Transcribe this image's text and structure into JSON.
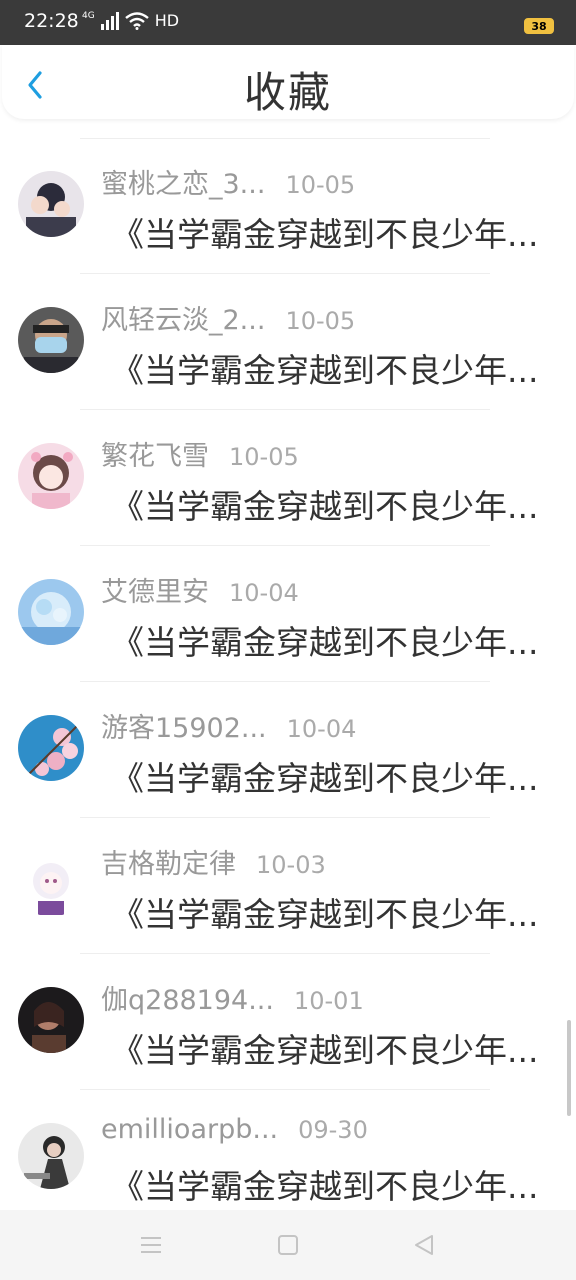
{
  "status_bar": {
    "time": "22:28",
    "network": "4G",
    "hd": "HD",
    "battery": "38"
  },
  "header": {
    "title": "收藏",
    "back_icon": "chevron-left-icon"
  },
  "colors": {
    "accent": "#1e9ee0",
    "status_bar_bg": "#3a3a3a",
    "name_text": "#999999",
    "title_text": "#333333"
  },
  "items": [
    {
      "name": "蜜桃之恋_3...",
      "date": "10-05",
      "title": "《当学霸金穿越到不良少年..."
    },
    {
      "name": "风轻云淡_2...",
      "date": "10-05",
      "title": "《当学霸金穿越到不良少年..."
    },
    {
      "name": "繁花飞雪",
      "date": "10-05",
      "title": "《当学霸金穿越到不良少年..."
    },
    {
      "name": "艾德里安",
      "date": "10-04",
      "title": "《当学霸金穿越到不良少年..."
    },
    {
      "name": "游客15902...",
      "date": "10-04",
      "title": "《当学霸金穿越到不良少年..."
    },
    {
      "name": "吉格勒定律",
      "date": "10-03",
      "title": "《当学霸金穿越到不良少年..."
    },
    {
      "name": "伽q288194...",
      "date": "10-01",
      "title": "《当学霸金穿越到不良少年..."
    },
    {
      "name": "emillioarpb...",
      "date": "09-30",
      "title": "《当学霸金穿越到不良少年..."
    }
  ],
  "nav_bar": {
    "menu_icon": "menu-icon",
    "home_icon": "home-square-icon",
    "back_icon": "back-triangle-icon"
  }
}
